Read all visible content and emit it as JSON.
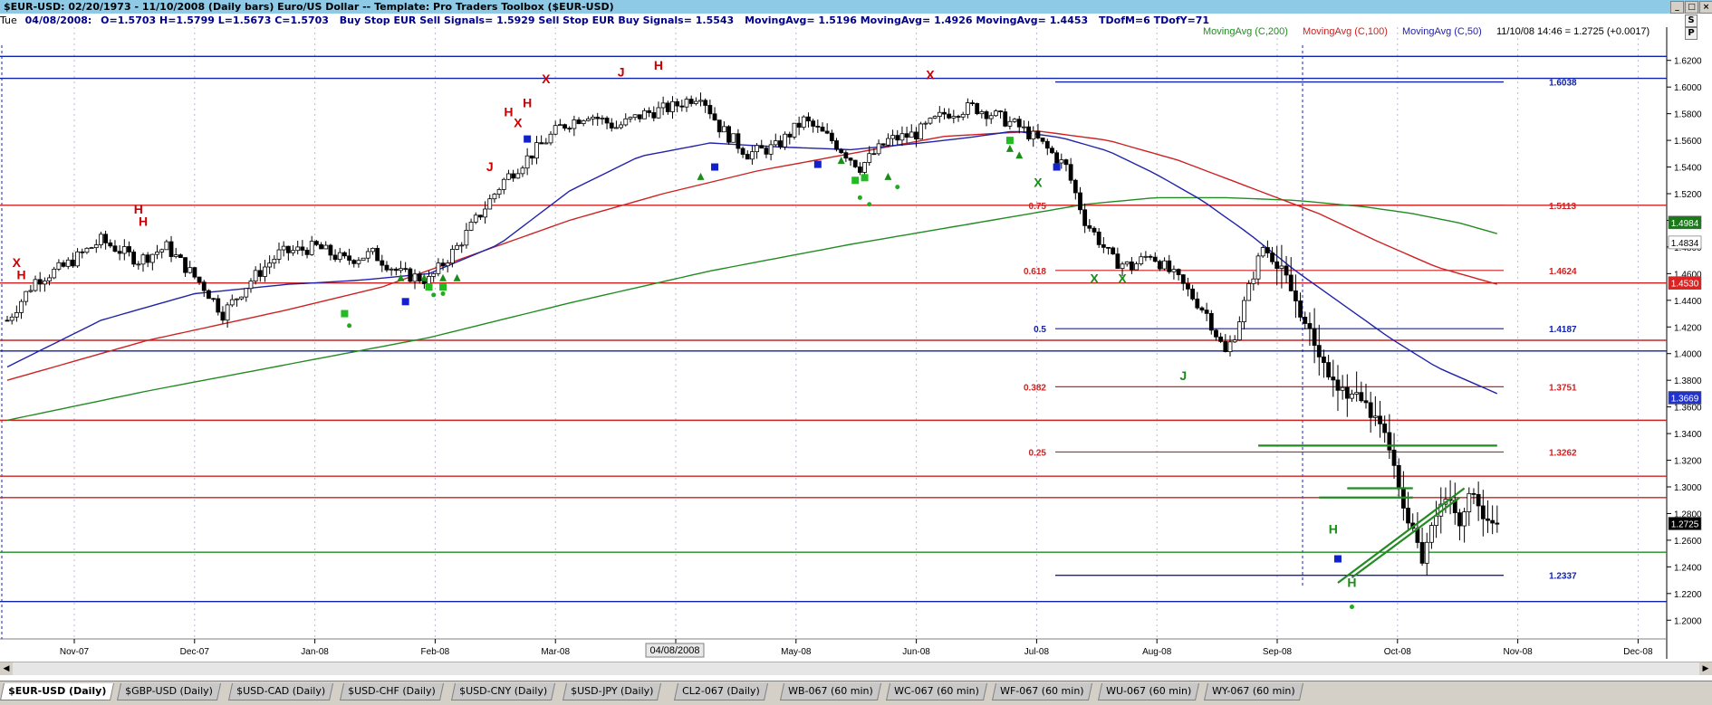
{
  "window": {
    "title": "$EUR-USD:  02/20/1973 - 11/10/2008  (Daily bars)   Euro/US Dollar  --  Template: Pro Traders Toolbox ($EUR-USD)",
    "scroll_buttons": [
      "S",
      "P"
    ]
  },
  "infobar": {
    "day": "Tue",
    "date": "04/08/2008:",
    "ohlc": "O=1.5703  H=1.5799  L=1.5673  C=1.5703",
    "signals": "Buy Stop EUR Sell Signals= 1.5929   Sell Stop EUR Buy Signals= 1.5543",
    "mas": "MovingAvg= 1.5196   MovingAvg= 1.4926   MovingAvg= 1.4453",
    "tdom": "TDofM=6   TDofY=71"
  },
  "legend": {
    "ma200": "MovingAvg (C,200)",
    "ma100": "MovingAvg (C,100)",
    "ma50": "MovingAvg (C,50)",
    "last_quote": "11/10/08 14:46 = 1.2725 (+0.0017)"
  },
  "cursor_date": "04/08/2008",
  "colors": {
    "ma200": "#228b22",
    "ma100": "#cc2222",
    "ma50": "#2222aa",
    "bars": "#000000",
    "signal_red": "#cc0000",
    "signal_green": "#1a8c1a",
    "dot_green": "#22aa22",
    "square_blue": "#1122cc"
  },
  "chart_data": {
    "type": "candlestick",
    "symbol": "$EUR-USD",
    "timeframe": "Daily",
    "ylim": [
      1.19,
      1.63
    ],
    "yticks": [
      "1.6200",
      "1.6000",
      "1.5800",
      "1.5600",
      "1.5400",
      "1.5200",
      "1.5000",
      "1.4800",
      "1.4600",
      "1.4400",
      "1.4200",
      "1.4000",
      "1.3800",
      "1.3600",
      "1.3400",
      "1.3200",
      "1.3000",
      "1.2800",
      "1.2600",
      "1.2400",
      "1.2200",
      "1.2000"
    ],
    "xticks": [
      "Nov-07",
      "Dec-07",
      "Jan-08",
      "Feb-08",
      "Mar-08",
      "Apr-08",
      "May-08",
      "Jun-08",
      "Jul-08",
      "Aug-08",
      "Sep-08",
      "Oct-08",
      "Nov-08",
      "Dec-08"
    ],
    "price_path": [
      [
        0,
        1.425
      ],
      [
        6,
        1.455
      ],
      [
        12,
        1.465
      ],
      [
        20,
        1.485
      ],
      [
        28,
        1.47
      ],
      [
        34,
        1.48
      ],
      [
        42,
        1.45
      ],
      [
        46,
        1.43
      ],
      [
        52,
        1.455
      ],
      [
        58,
        1.475
      ],
      [
        66,
        1.48
      ],
      [
        72,
        1.47
      ],
      [
        78,
        1.475
      ],
      [
        84,
        1.46
      ],
      [
        90,
        1.455
      ],
      [
        96,
        1.48
      ],
      [
        100,
        1.5
      ],
      [
        106,
        1.53
      ],
      [
        112,
        1.55
      ],
      [
        118,
        1.57
      ],
      [
        124,
        1.58
      ],
      [
        130,
        1.57
      ],
      [
        136,
        1.58
      ],
      [
        142,
        1.585
      ],
      [
        148,
        1.595
      ],
      [
        152,
        1.57
      ],
      [
        158,
        1.55
      ],
      [
        164,
        1.555
      ],
      [
        170,
        1.575
      ],
      [
        176,
        1.56
      ],
      [
        182,
        1.54
      ],
      [
        188,
        1.56
      ],
      [
        194,
        1.565
      ],
      [
        200,
        1.58
      ],
      [
        206,
        1.585
      ],
      [
        210,
        1.58
      ],
      [
        216,
        1.57
      ],
      [
        220,
        1.56
      ],
      [
        226,
        1.54
      ],
      [
        230,
        1.5
      ],
      [
        236,
        1.47
      ],
      [
        240,
        1.465
      ],
      [
        244,
        1.475
      ],
      [
        250,
        1.455
      ],
      [
        256,
        1.43
      ],
      [
        260,
        1.4
      ],
      [
        262,
        1.415
      ],
      [
        266,
        1.46
      ],
      [
        268,
        1.48
      ],
      [
        272,
        1.465
      ],
      [
        276,
        1.43
      ],
      [
        280,
        1.4
      ],
      [
        284,
        1.37
      ],
      [
        288,
        1.37
      ],
      [
        292,
        1.35
      ],
      [
        295,
        1.33
      ],
      [
        298,
        1.28
      ],
      [
        300,
        1.265
      ],
      [
        302,
        1.245
      ],
      [
        304,
        1.275
      ],
      [
        306,
        1.29
      ],
      [
        308,
        1.285
      ],
      [
        310,
        1.275
      ],
      [
        312,
        1.295
      ],
      [
        314,
        1.285
      ],
      [
        316,
        1.275
      ],
      [
        318,
        1.2725
      ]
    ],
    "moving_averages": [
      {
        "name": "MovingAvg (C,200)",
        "color": "#228b22",
        "points": [
          [
            0,
            1.35
          ],
          [
            30,
            1.372
          ],
          [
            60,
            1.392
          ],
          [
            90,
            1.412
          ],
          [
            120,
            1.438
          ],
          [
            150,
            1.462
          ],
          [
            180,
            1.482
          ],
          [
            210,
            1.5
          ],
          [
            230,
            1.512
          ],
          [
            245,
            1.517
          ],
          [
            260,
            1.517
          ],
          [
            275,
            1.515
          ],
          [
            290,
            1.51
          ],
          [
            300,
            1.505
          ],
          [
            310,
            1.498
          ],
          [
            318,
            1.49
          ]
        ]
      },
      {
        "name": "MovingAvg (C,100)",
        "color": "#cc2222",
        "points": [
          [
            0,
            1.38
          ],
          [
            30,
            1.41
          ],
          [
            60,
            1.433
          ],
          [
            80,
            1.45
          ],
          [
            100,
            1.475
          ],
          [
            120,
            1.5
          ],
          [
            140,
            1.52
          ],
          [
            160,
            1.537
          ],
          [
            180,
            1.55
          ],
          [
            200,
            1.563
          ],
          [
            220,
            1.567
          ],
          [
            235,
            1.56
          ],
          [
            250,
            1.545
          ],
          [
            265,
            1.525
          ],
          [
            280,
            1.505
          ],
          [
            292,
            1.485
          ],
          [
            305,
            1.465
          ],
          [
            318,
            1.452
          ]
        ]
      },
      {
        "name": "MovingAvg (C,50)",
        "color": "#2222aa",
        "points": [
          [
            0,
            1.39
          ],
          [
            20,
            1.425
          ],
          [
            40,
            1.445
          ],
          [
            60,
            1.452
          ],
          [
            75,
            1.455
          ],
          [
            90,
            1.46
          ],
          [
            105,
            1.482
          ],
          [
            120,
            1.522
          ],
          [
            135,
            1.548
          ],
          [
            150,
            1.558
          ],
          [
            165,
            1.555
          ],
          [
            180,
            1.553
          ],
          [
            195,
            1.558
          ],
          [
            205,
            1.562
          ],
          [
            215,
            1.567
          ],
          [
            225,
            1.562
          ],
          [
            235,
            1.552
          ],
          [
            245,
            1.535
          ],
          [
            255,
            1.515
          ],
          [
            265,
            1.49
          ],
          [
            275,
            1.462
          ],
          [
            285,
            1.437
          ],
          [
            295,
            1.412
          ],
          [
            305,
            1.39
          ],
          [
            318,
            1.37
          ]
        ]
      }
    ],
    "fibonacci": {
      "levels": [
        {
          "ratio": "0.75",
          "value": "1.5113"
        },
        {
          "ratio": "0.618",
          "value": "1.4624"
        },
        {
          "ratio": "0.5",
          "value": "1.4187"
        },
        {
          "ratio": "0.382",
          "value": "1.3751"
        },
        {
          "ratio": "0.25",
          "value": "1.3262"
        }
      ],
      "high": "1.6038",
      "low": "1.2337"
    },
    "horizontal_lines": [
      {
        "value": 1.623,
        "color": "#1122aa"
      },
      {
        "value": 1.6065,
        "color": "#1122aa"
      },
      {
        "value": 1.5113,
        "color": "#cc2222"
      },
      {
        "value": 1.453,
        "color": "#cc2222"
      },
      {
        "value": 1.41,
        "color": "#cc2222"
      },
      {
        "value": 1.402,
        "color": "#1122aa"
      },
      {
        "value": 1.35,
        "color": "#cc2222"
      },
      {
        "value": 1.308,
        "color": "#cc2222"
      },
      {
        "value": 1.292,
        "color": "#cc2222"
      },
      {
        "value": 1.251,
        "color": "#228b22"
      },
      {
        "value": 1.214,
        "color": "#1122aa"
      }
    ],
    "price_badges": [
      {
        "text": "1.4984",
        "value": 1.4984,
        "bg": "#1a7a1a",
        "fg": "#ffffff"
      },
      {
        "text": "1.4834",
        "value": 1.4834,
        "bg": "#ffffff",
        "fg": "#000000"
      },
      {
        "text": "1.4530",
        "value": 1.453,
        "bg": "#dd2222",
        "fg": "#ffffff"
      },
      {
        "text": "1.3669",
        "value": 1.3669,
        "bg": "#2233cc",
        "fg": "#ffffff"
      },
      {
        "text": "1.2725",
        "value": 1.2725,
        "bg": "#000000",
        "fg": "#ffffff"
      }
    ],
    "signal_markers": [
      {
        "bar": 2,
        "value": 1.465,
        "glyph": "X",
        "color": "#cc0000"
      },
      {
        "bar": 3,
        "value": 1.456,
        "glyph": "H",
        "color": "#cc0000"
      },
      {
        "bar": 28,
        "value": 1.505,
        "glyph": "H",
        "color": "#cc0000"
      },
      {
        "bar": 29,
        "value": 1.496,
        "glyph": "H",
        "color": "#cc0000"
      },
      {
        "bar": 103,
        "value": 1.537,
        "glyph": "J",
        "color": "#cc0000"
      },
      {
        "bar": 107,
        "value": 1.578,
        "glyph": "H",
        "color": "#cc0000"
      },
      {
        "bar": 109,
        "value": 1.57,
        "glyph": "X",
        "color": "#cc0000"
      },
      {
        "bar": 111,
        "value": 1.585,
        "glyph": "H",
        "color": "#cc0000"
      },
      {
        "bar": 115,
        "value": 1.603,
        "glyph": "X",
        "color": "#cc0000"
      },
      {
        "bar": 131,
        "value": 1.608,
        "glyph": "J",
        "color": "#cc0000"
      },
      {
        "bar": 139,
        "value": 1.613,
        "glyph": "H",
        "color": "#cc0000"
      },
      {
        "bar": 197,
        "value": 1.606,
        "glyph": "X",
        "color": "#cc0000"
      },
      {
        "bar": 232,
        "value": 1.453,
        "glyph": "X",
        "color": "#1a8c1a"
      },
      {
        "bar": 238,
        "value": 1.453,
        "glyph": "X",
        "color": "#1a8c1a"
      },
      {
        "bar": 220,
        "value": 1.525,
        "glyph": "X",
        "color": "#1a8c1a"
      },
      {
        "bar": 251,
        "value": 1.38,
        "glyph": "J",
        "color": "#1a8c1a"
      },
      {
        "bar": 283,
        "value": 1.265,
        "glyph": "H",
        "color": "#1a8c1a"
      },
      {
        "bar": 287,
        "value": 1.225,
        "glyph": "H",
        "color": "#1a8c1a"
      }
    ],
    "triangle_markers": [
      [
        84,
        1.457
      ],
      [
        89,
        1.457
      ],
      [
        93,
        1.457
      ],
      [
        96,
        1.457
      ],
      [
        148,
        1.533
      ],
      [
        178,
        1.545
      ],
      [
        188,
        1.533
      ],
      [
        214,
        1.554
      ],
      [
        216,
        1.549
      ]
    ],
    "dots": [
      [
        73,
        1.421
      ],
      [
        91,
        1.444
      ],
      [
        93,
        1.445
      ],
      [
        182,
        1.517
      ],
      [
        184,
        1.512
      ],
      [
        190,
        1.525
      ],
      [
        287,
        1.21
      ]
    ],
    "squares": [
      [
        72,
        1.43
      ],
      [
        85,
        1.439
      ],
      [
        90,
        1.45
      ],
      [
        93,
        1.45
      ],
      [
        111,
        1.561
      ],
      [
        151,
        1.54
      ],
      [
        173,
        1.542
      ],
      [
        181,
        1.53
      ],
      [
        183,
        1.532
      ],
      [
        214,
        1.56
      ],
      [
        224,
        1.54
      ],
      [
        284,
        1.246
      ]
    ],
    "trend_lines": [
      {
        "from": [
          267,
          1.331
        ],
        "to": [
          318,
          1.331
        ],
        "color": "#228b22"
      },
      {
        "from": [
          280,
          1.292
        ],
        "to": [
          300,
          1.292
        ],
        "color": "#228b22"
      },
      {
        "from": [
          286,
          1.299
        ],
        "to": [
          300,
          1.299
        ],
        "color": "#228b22"
      },
      {
        "from": [
          284,
          1.228
        ],
        "to": [
          311,
          1.299
        ],
        "color": "#228b22"
      },
      {
        "from": [
          287,
          1.232
        ],
        "to": [
          310,
          1.292
        ],
        "color": "#228b22"
      }
    ]
  },
  "tabs": [
    {
      "label": "$EUR-USD (Daily)",
      "active": true
    },
    {
      "label": "$GBP-USD (Daily)"
    },
    {
      "label": "$USD-CAD (Daily)"
    },
    {
      "label": "$USD-CHF (Daily)"
    },
    {
      "label": "$USD-CNY (Daily)"
    },
    {
      "label": "$USD-JPY (Daily)"
    },
    {
      "label": "CL2-067 (Daily)"
    },
    {
      "label": "WB-067 (60 min)"
    },
    {
      "label": "WC-067 (60 min)"
    },
    {
      "label": "WF-067 (60 min)"
    },
    {
      "label": "WU-067 (60 min)"
    },
    {
      "label": "WY-067 (60 min)"
    }
  ]
}
